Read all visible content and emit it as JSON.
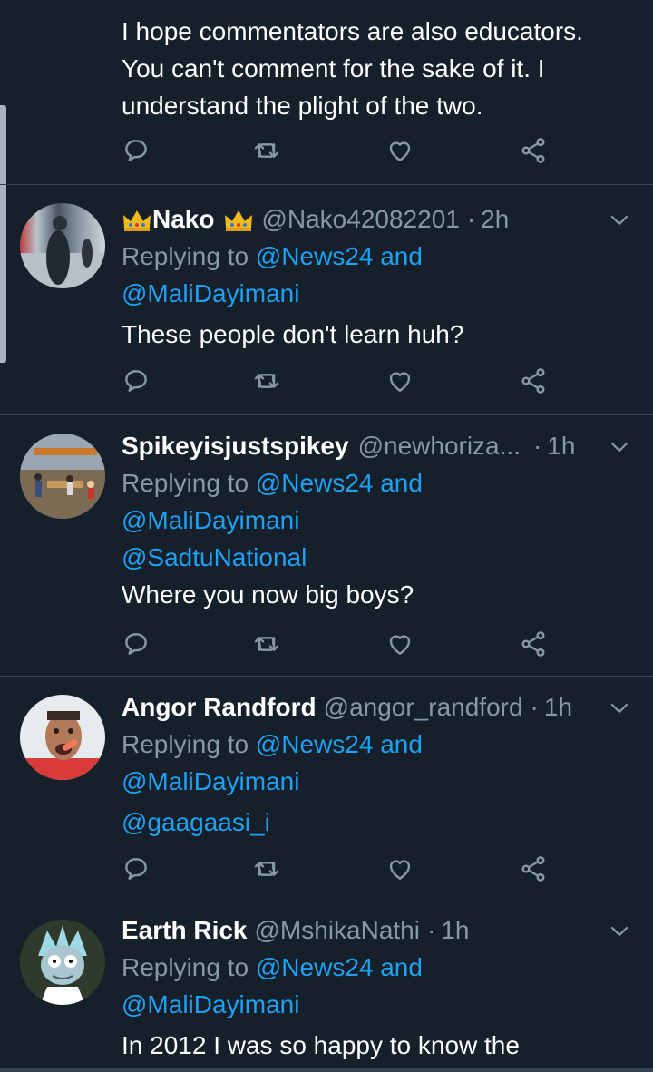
{
  "tweets": [
    {
      "name": "",
      "handle": "",
      "time": "",
      "lines": [
        "I hope commentators are also educators.",
        "You can't comment for the sake of it. I",
        "understand the plight of the two."
      ]
    },
    {
      "name": "Nako",
      "handle": "@Nako42082201",
      "dot": "·",
      "time": "2h",
      "replying_prefix": "Replying to",
      "replying_first": "@News24 and",
      "replying_more": [
        "@MaliDayimani"
      ],
      "text": "These people don't learn huh?"
    },
    {
      "name": "Spikeyisjustspikey",
      "handle": "@newhoriza...",
      "dot": "·",
      "time": "1h",
      "replying_prefix": "Replying to",
      "replying_first": "@News24 and",
      "replying_more": [
        "@MaliDayimani",
        "@SadtuNational"
      ],
      "text": "Where you now big boys?"
    },
    {
      "name": "Angor Randford",
      "handle": "@angor_randford",
      "dot": "·",
      "time": "1h",
      "replying_prefix": "Replying to",
      "replying_first": "@News24 and",
      "replying_more": [
        "@MaliDayimani",
        "@gaagaasi_i"
      ],
      "text": ""
    },
    {
      "name": "Earth Rick",
      "handle": "@MshikaNathi",
      "dot": "·",
      "time": "1h",
      "replying_prefix": "Replying to",
      "replying_first": "@News24 and",
      "replying_more": [
        "@MaliDayimani"
      ],
      "text": "In 2012 I was so happy to know the"
    }
  ],
  "icons": {
    "reply": "reply-icon",
    "retweet": "retweet-icon",
    "like": "heart-icon",
    "share": "share-icon",
    "more": "chevron-down-icon",
    "crown": "crown-emoji"
  },
  "colors": {
    "background": "#15202b",
    "link": "#1da1f2",
    "muted": "#8899a6",
    "divider": "#38444d"
  }
}
